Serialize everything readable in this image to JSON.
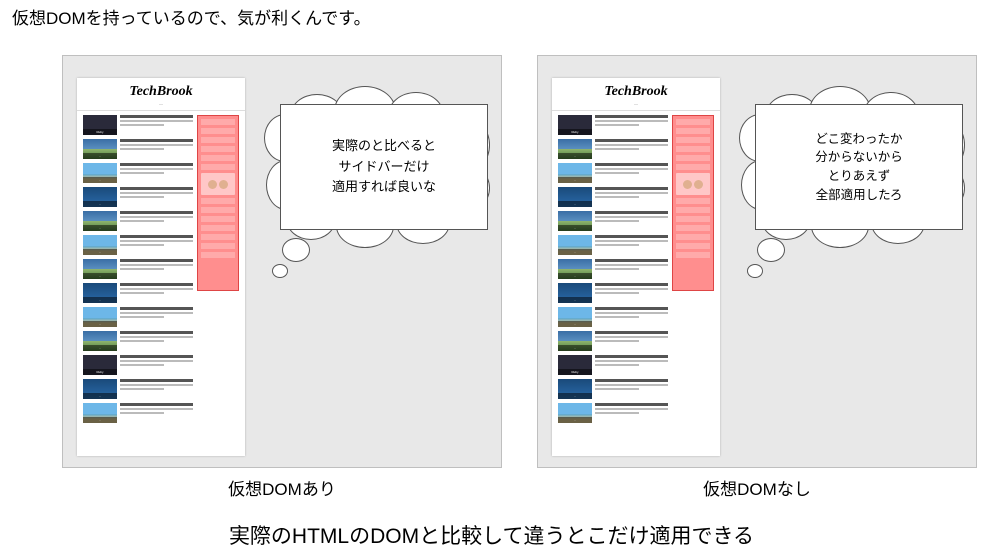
{
  "headline": "仮想DOMを持っているので、気が利くんです。",
  "panels": {
    "left": {
      "caption": "仮想DOMあり",
      "site_title": "TechBrook",
      "bubble_lines": [
        "実際のと比べると",
        "サイドバーだけ",
        "適用すれば良いな"
      ]
    },
    "right": {
      "caption": "仮想DOMなし",
      "site_title": "TechBrook",
      "bubble_lines": [
        "どこ変わったか",
        "分からないから",
        "とりあえず",
        "全部適用したろ"
      ]
    }
  },
  "bottom_text": "実際のHTMLのDOMと比較して違うとこだけ適用できる"
}
